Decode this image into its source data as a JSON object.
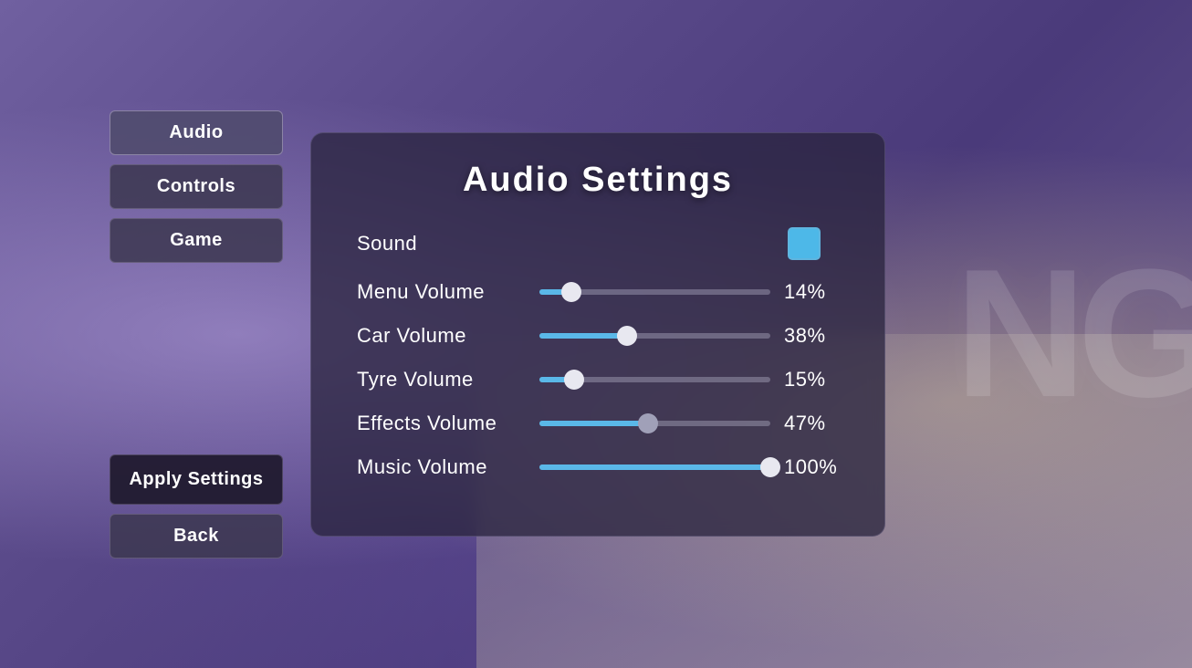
{
  "background": {
    "logo_text": "NG"
  },
  "sidebar": {
    "nav_items": [
      {
        "id": "audio",
        "label": "Audio",
        "active": true
      },
      {
        "id": "controls",
        "label": "Controls",
        "active": false
      },
      {
        "id": "game",
        "label": "Game",
        "active": false
      }
    ],
    "apply_label": "Apply Settings",
    "back_label": "Back"
  },
  "panel": {
    "title": "Audio  Settings",
    "rows": [
      {
        "id": "sound",
        "label": "Sound",
        "type": "checkbox",
        "checked": true
      },
      {
        "id": "menu-volume",
        "label": "Menu Volume",
        "type": "slider",
        "value": 14,
        "value_display": "14%",
        "fill_color": "#5ab8e8",
        "thumb_color": "#e8e8f0"
      },
      {
        "id": "car-volume",
        "label": "Car Volume",
        "type": "slider",
        "value": 38,
        "value_display": "38%",
        "fill_color": "#5ab8e8",
        "thumb_color": "#e8e8f0"
      },
      {
        "id": "tyre-volume",
        "label": "Tyre Volume",
        "type": "slider",
        "value": 15,
        "value_display": "15%",
        "fill_color": "#5ab8e8",
        "thumb_color": "#e8e8f0"
      },
      {
        "id": "effects-volume",
        "label": "Effects Volume",
        "type": "slider",
        "value": 47,
        "value_display": "47%",
        "fill_color": "#5ab8e8",
        "thumb_color": "#a0a0b8"
      },
      {
        "id": "music-volume",
        "label": "Music Volume",
        "type": "slider",
        "value": 100,
        "value_display": "100%",
        "fill_color": "#5ab8e8",
        "thumb_color": "#e8e8f0"
      }
    ]
  }
}
